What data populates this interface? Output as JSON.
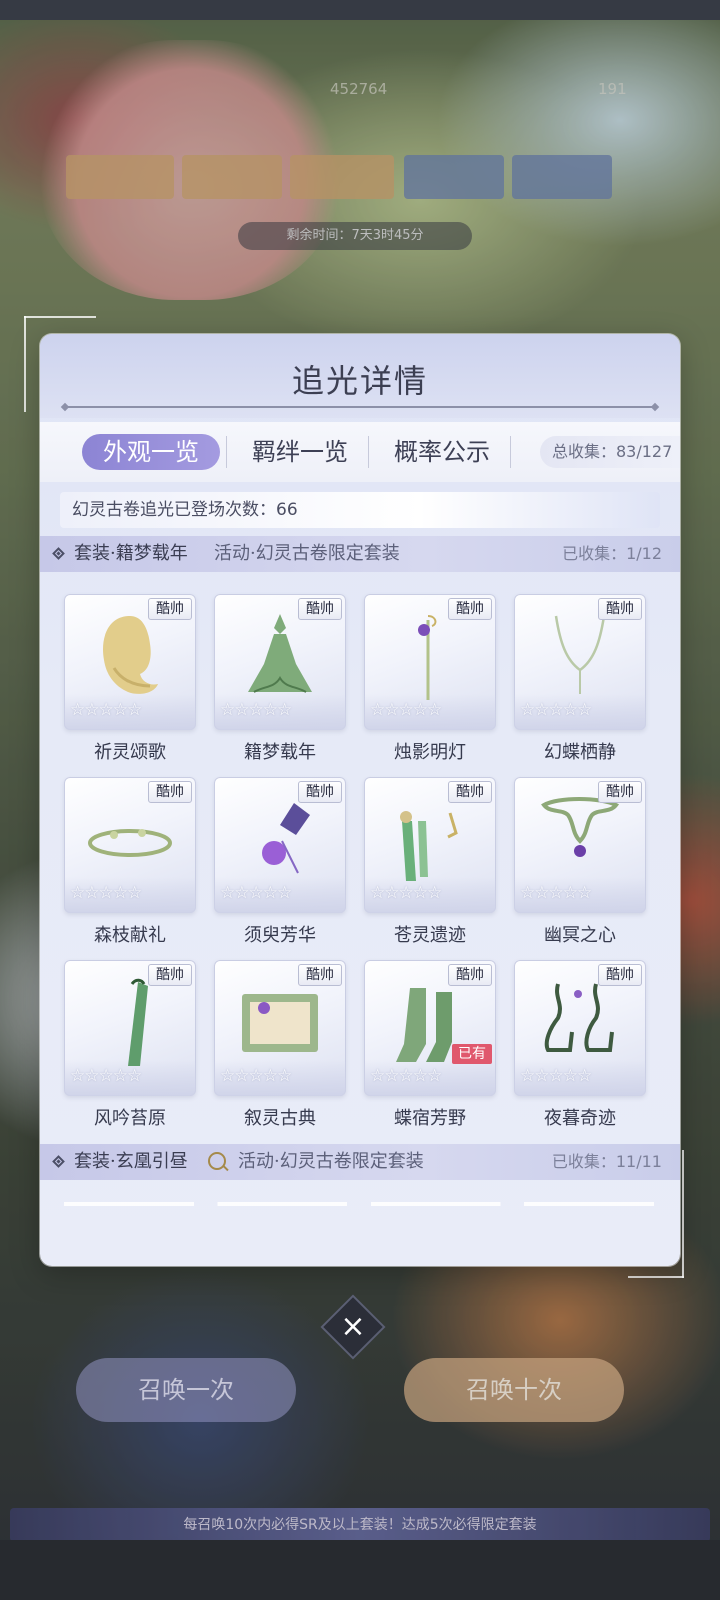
{
  "background": {
    "currency_1": "452764",
    "currency_2": "191",
    "timer": "剩余时间：7天3时45分",
    "draw_once": "召唤一次",
    "draw_ten": "召唤十次",
    "banner": "每召唤10次内必得SR及以上套装！达成5次必得限定套装"
  },
  "dialog": {
    "title": "追光详情",
    "tabs": [
      "外观一览",
      "羁绊一览",
      "概率公示"
    ],
    "active_tab": "外观一览",
    "total_collected": "总收集：83/127",
    "appear_count": "幻灵古卷追光已登场次数：66"
  },
  "sections": [
    {
      "name": "套装·籍梦载年",
      "source": "活动·幻灵古卷限定套装",
      "collected": "已收集：1/12",
      "items": [
        {
          "name": "祈灵颂歌",
          "tag": "酷帅",
          "stars": "☆☆☆☆☆",
          "owned": false,
          "icon": "hair-icon"
        },
        {
          "name": "籍梦载年",
          "tag": "酷帅",
          "stars": "☆☆☆☆☆",
          "owned": false,
          "icon": "dress-icon"
        },
        {
          "name": "烛影明灯",
          "tag": "酷帅",
          "stars": "☆☆☆☆☆",
          "owned": false,
          "icon": "staff-icon"
        },
        {
          "name": "幻蝶栖静",
          "tag": "酷帅",
          "stars": "☆☆☆☆☆",
          "owned": false,
          "icon": "necklace-icon"
        },
        {
          "name": "森枝献礼",
          "tag": "酷帅",
          "stars": "☆☆☆☆☆",
          "owned": false,
          "icon": "crown-icon"
        },
        {
          "name": "须臾芳华",
          "tag": "酷帅",
          "stars": "☆☆☆☆☆",
          "owned": false,
          "icon": "butterfly-hairpin-icon"
        },
        {
          "name": "苍灵遗迹",
          "tag": "酷帅",
          "stars": "☆☆☆☆☆",
          "owned": false,
          "icon": "earrings-icon"
        },
        {
          "name": "幽冥之心",
          "tag": "酷帅",
          "stars": "☆☆☆☆☆",
          "owned": false,
          "icon": "pendant-icon"
        },
        {
          "name": "风吟苔原",
          "tag": "酷帅",
          "stars": "☆☆☆☆☆",
          "owned": false,
          "icon": "glove-icon"
        },
        {
          "name": "叙灵古典",
          "tag": "酷帅",
          "stars": "☆☆☆☆☆",
          "owned": false,
          "icon": "book-icon"
        },
        {
          "name": "蝶宿芳野",
          "tag": "酷帅",
          "stars": "☆☆☆☆☆",
          "owned": true,
          "owned_label": "已有",
          "icon": "stockings-icon"
        },
        {
          "name": "夜暮奇迹",
          "tag": "酷帅",
          "stars": "☆☆☆☆☆",
          "owned": false,
          "icon": "heels-icon"
        }
      ]
    },
    {
      "name": "套装·玄凰引昼",
      "source": "活动·幻灵古卷限定套装",
      "collected": "已收集：11/11"
    }
  ],
  "close_label": "×"
}
